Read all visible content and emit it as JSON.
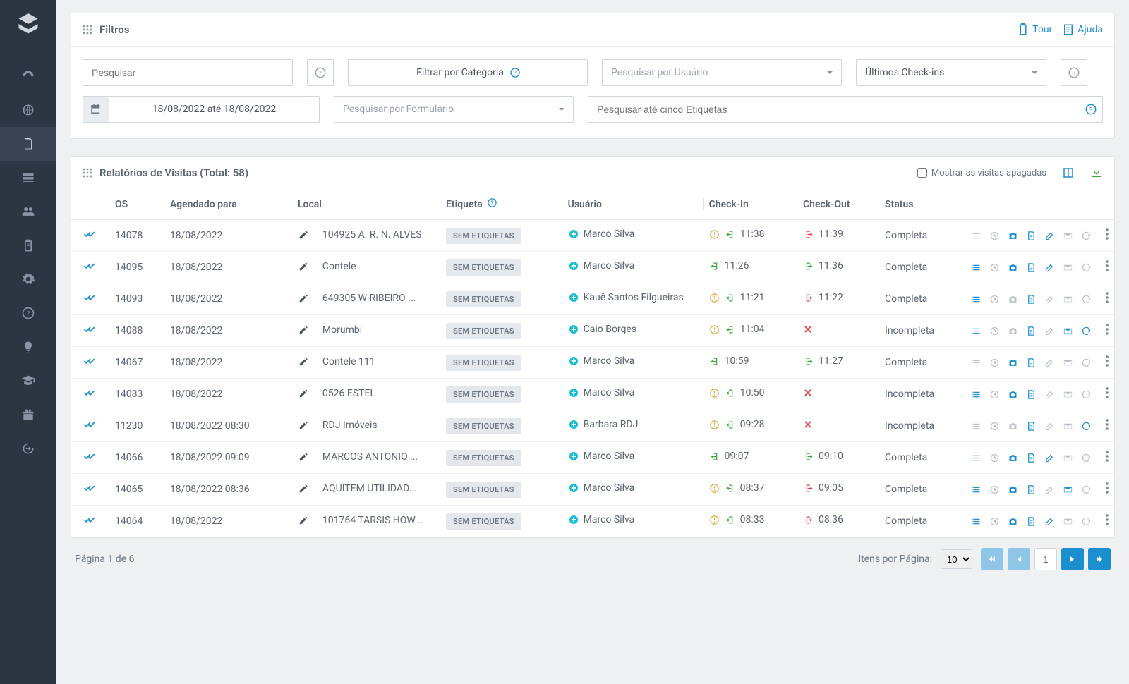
{
  "header": {
    "filters_title": "Filtros",
    "tour_label": "Tour",
    "help_label": "Ajuda"
  },
  "filters": {
    "search_placeholder": "Pesquisar",
    "category_label": "Filtrar por Categoria",
    "user_label": "Pesquisar por Usuário",
    "checkins_label": "Últimos Check-ins",
    "date_range": "18/08/2022 até 18/08/2022",
    "form_label": "Pesquisar por Formulario",
    "tags_placeholder": "Pesquisar até cinco Etiquetas"
  },
  "reports": {
    "title": "Relatórios de Visitas (Total: 58)",
    "show_deleted_label": "Mostrar as visitas apagadas",
    "columns": {
      "os": "OS",
      "scheduled": "Agendado para",
      "location": "Local",
      "tag": "Etiqueta",
      "user": "Usuário",
      "checkin": "Check-In",
      "checkout": "Check-Out",
      "status": "Status"
    },
    "tag_badge": "SEM ETIQUETAS",
    "status_complete": "Completa",
    "status_incomplete": "Incompleta"
  },
  "rows": [
    {
      "os": "14078",
      "date": "18/08/2022",
      "loc": "104925 A. R. N. ALVES",
      "user": "Marco Silva",
      "warn": true,
      "in": "11:38",
      "out": "11:39",
      "out_red": true,
      "status": "Completa",
      "acts": {
        "list": false,
        "clock": false,
        "cam": true,
        "doc": true,
        "edit": true,
        "mail": false,
        "refresh": false
      }
    },
    {
      "os": "14095",
      "date": "18/08/2022",
      "loc": "Contele",
      "user": "Marco Silva",
      "warn": false,
      "in": "11:26",
      "out": "11:36",
      "out_red": false,
      "status": "Completa",
      "acts": {
        "list": true,
        "clock": false,
        "cam": true,
        "doc": true,
        "edit": true,
        "mail": false,
        "refresh": false
      }
    },
    {
      "os": "14093",
      "date": "18/08/2022",
      "loc": "649305 W RIBEIRO ...",
      "user": "Kauê Santos Filgueiras",
      "warn": true,
      "in": "11:21",
      "out": "11:22",
      "out_red": true,
      "status": "Completa",
      "acts": {
        "list": true,
        "clock": false,
        "cam": false,
        "doc": true,
        "edit": false,
        "mail": false,
        "refresh": false
      }
    },
    {
      "os": "14088",
      "date": "18/08/2022",
      "loc": "Morumbi",
      "user": "Caio Borges",
      "warn": true,
      "in": "11:04",
      "out": null,
      "status": "Incompleta",
      "acts": {
        "list": true,
        "clock": false,
        "cam": false,
        "doc": true,
        "edit": false,
        "mail": true,
        "refresh": true
      }
    },
    {
      "os": "14067",
      "date": "18/08/2022",
      "loc": "Contele 111",
      "user": "Marco Silva",
      "warn": false,
      "in": "10:59",
      "out": "11:27",
      "out_red": false,
      "status": "Completa",
      "acts": {
        "list": false,
        "clock": false,
        "cam": true,
        "doc": true,
        "edit": false,
        "mail": false,
        "refresh": false
      }
    },
    {
      "os": "14083",
      "date": "18/08/2022",
      "loc": "0526 ESTEL",
      "user": "Marco Silva",
      "warn": true,
      "in": "10:50",
      "out": null,
      "status": "Incompleta",
      "acts": {
        "list": true,
        "clock": false,
        "cam": true,
        "doc": true,
        "edit": false,
        "mail": false,
        "refresh": false
      }
    },
    {
      "os": "11230",
      "date": "18/08/2022 08:30",
      "loc": "RDJ Imóveis",
      "user": "Barbara RDJ",
      "warn": true,
      "in": "09:28",
      "out": null,
      "status": "Incompleta",
      "acts": {
        "list": false,
        "clock": false,
        "cam": false,
        "doc": true,
        "edit": false,
        "mail": false,
        "refresh": true
      }
    },
    {
      "os": "14066",
      "date": "18/08/2022 09:09",
      "loc": "MARCOS ANTONIO ...",
      "user": "Marco Silva",
      "warn": false,
      "in": "09:07",
      "out": "09:10",
      "out_red": false,
      "status": "Completa",
      "acts": {
        "list": true,
        "clock": false,
        "cam": true,
        "doc": true,
        "edit": true,
        "mail": false,
        "refresh": false
      }
    },
    {
      "os": "14065",
      "date": "18/08/2022 08:36",
      "loc": "AQUITEM UTILIDAD...",
      "user": "Marco Silva",
      "warn": true,
      "in": "08:37",
      "out": "09:05",
      "out_red": true,
      "status": "Completa",
      "acts": {
        "list": true,
        "clock": false,
        "cam": true,
        "doc": true,
        "edit": false,
        "mail": true,
        "refresh": false
      }
    },
    {
      "os": "14064",
      "date": "18/08/2022",
      "loc": "101764 TARSIS HOW...",
      "user": "Marco Silva",
      "warn": true,
      "in": "08:33",
      "out": "08:36",
      "out_red": true,
      "status": "Completa",
      "acts": {
        "list": true,
        "clock": false,
        "cam": true,
        "doc": true,
        "edit": true,
        "mail": false,
        "refresh": false
      }
    }
  ],
  "footer": {
    "page_label": "Página 1 de 6",
    "items_per_page_label": "Itens por Página:",
    "per_page": "10",
    "current_page": "1"
  },
  "colors": {
    "primary": "#1b8ecf",
    "sidenav": "#2c3542",
    "success": "#39a83a",
    "danger": "#e43c3c",
    "warn": "#e0a83e",
    "teal": "#17becf"
  }
}
